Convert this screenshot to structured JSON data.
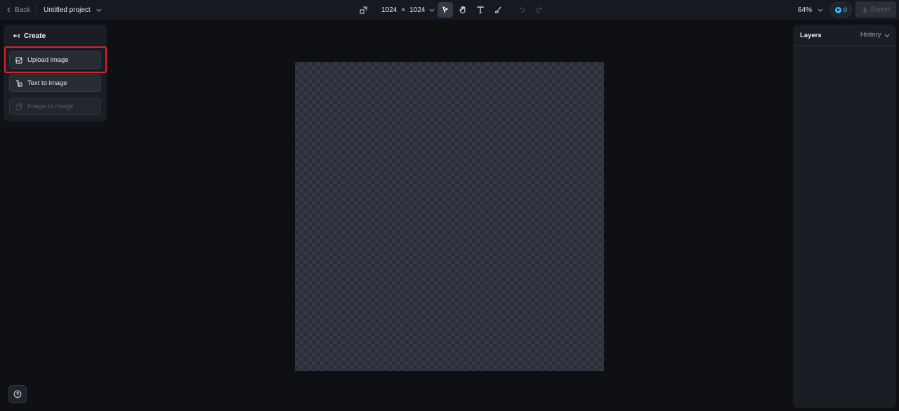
{
  "topbar": {
    "back_label": "Back",
    "project_name": "Untitled project",
    "canvas_width": "1024",
    "times_sign": "×",
    "canvas_height": "1024",
    "zoom": "64%",
    "credits": "0",
    "export_label": "Export"
  },
  "tools": [
    {
      "name": "select-tool",
      "icon": "cursor-icon",
      "active": true
    },
    {
      "name": "hand-tool",
      "icon": "hand-icon",
      "active": false
    },
    {
      "name": "text-tool",
      "icon": "text-icon",
      "active": false
    },
    {
      "name": "brush-tool",
      "icon": "brush-icon",
      "active": false
    },
    {
      "name": "undo",
      "icon": "undo-icon",
      "disabled": true
    },
    {
      "name": "redo",
      "icon": "redo-icon",
      "disabled": true
    }
  ],
  "left_panel": {
    "title": "Create",
    "buttons": [
      {
        "label": "Upload image",
        "icon": "upload-image-icon",
        "highlighted": true
      },
      {
        "label": "Text to image",
        "icon": "text-to-image-icon"
      },
      {
        "label": "Image to image",
        "icon": "image-to-image-icon",
        "disabled": true
      }
    ]
  },
  "right_panel": {
    "layers_title": "Layers",
    "history_label": "History"
  },
  "colors": {
    "background": "#0e1014",
    "panel": "#1a1d23",
    "highlight": "#dc1e2d",
    "credit_accent": "#38bdf8"
  }
}
